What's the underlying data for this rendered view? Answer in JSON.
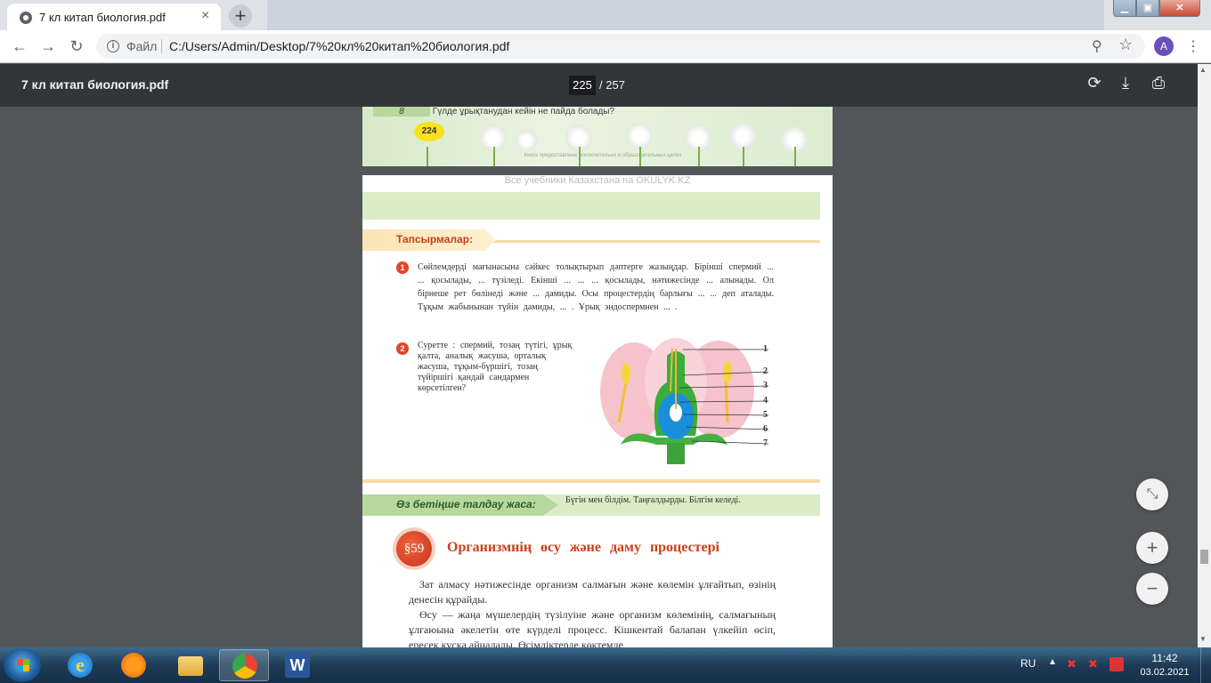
{
  "browser": {
    "tab_title": "7 кл китап биология.pdf",
    "new_tab_symbol": "+",
    "window_buttons": {
      "minimize": "▁",
      "maximize": "▣",
      "close": "✕"
    },
    "address": {
      "scheme_label": "Файл",
      "url": "C:/Users/Admin/Desktop/7%20кл%20китап%20биология.pdf"
    },
    "profile_initial": "A",
    "icons": [
      "back-icon",
      "forward-icon",
      "reload-icon",
      "info-icon",
      "zoom-icon",
      "star-icon",
      "menu-icon"
    ]
  },
  "pdf_toolbar": {
    "title": "7 кл китап биология.pdf",
    "current_page": "225",
    "total_pages": "/ 257",
    "icons": [
      "rotate-icon",
      "download-icon",
      "print-icon"
    ]
  },
  "prev_page": {
    "question_number": "8",
    "question_text": "Гүлде ұрықтанудан кейін не пайда болады?",
    "page_number": "224",
    "footer": "Книга предоставлена исключительно в образовательных целях"
  },
  "current_page": {
    "watermark": "Все учебники Казахстана на OKULYK.KZ",
    "tasks_label": "Тапсырмалар:",
    "q1_number": "1",
    "q1_text": "Сөйлемдерді мағынасына сәйкес толықтырып дәптерге жазыңдар. Бірінші спермий ... ... қосылады, ... түзіледі. Екінші ... ... ... қосылады, нәтижесінде ... алынады. Ол бірнеше рет бөлінеді және ... дамиды. Осы процестердің барлығы ... ... деп аталады. Тұқым жабынынан түйін дамиды, ... . Ұрық эндоспермнен ... .",
    "q2_number": "2",
    "q2_text": "Суретте : спермий, тозаң түтігі, ұрық қалта, аналық жасуша, орталық жасуша, тұқым-бүршігі, тозаң түйіршігі қандай сандармен көрсетілген?",
    "flower_labels": [
      "1",
      "2",
      "3",
      "4",
      "5",
      "6",
      "7"
    ],
    "review_label": "Өз бетіңше талдау жаса:",
    "review_text": "Бүгін мен білдім. Таңғалдырды. Білгім келеді.",
    "section_badge": "§59",
    "section_title": "Организмнің өсу және даму процестері",
    "para1": "Зат алмасу нәтижесінде организм салмағын және көлемін ұлғайтып, өзінің денесін құрайды.",
    "para2": "Өсу — жаңа мүшелердің түзілуіне және организм көлемінің, салмағының ұлғаюына әкелетін өте күрделі процесс. Кішкентай балапан үлкейіп өсіп, ересек құсқа айналады. Өсімдіктерде көктемде"
  },
  "zoom_controls": {
    "fit": "⤡",
    "zoom_in": "+",
    "zoom_out": "−"
  },
  "taskbar": {
    "language": "RU",
    "time": "11:42",
    "date": "03.02.2021",
    "pinned": [
      "internet-explorer-icon",
      "avast-icon",
      "file-explorer-icon",
      "chrome-icon",
      "word-icon"
    ]
  },
  "colors": {
    "accent_red": "#c8401a",
    "pdf_toolbar": "#323639",
    "viewer_bg": "#525659",
    "green_band": "#d9ecc6"
  }
}
